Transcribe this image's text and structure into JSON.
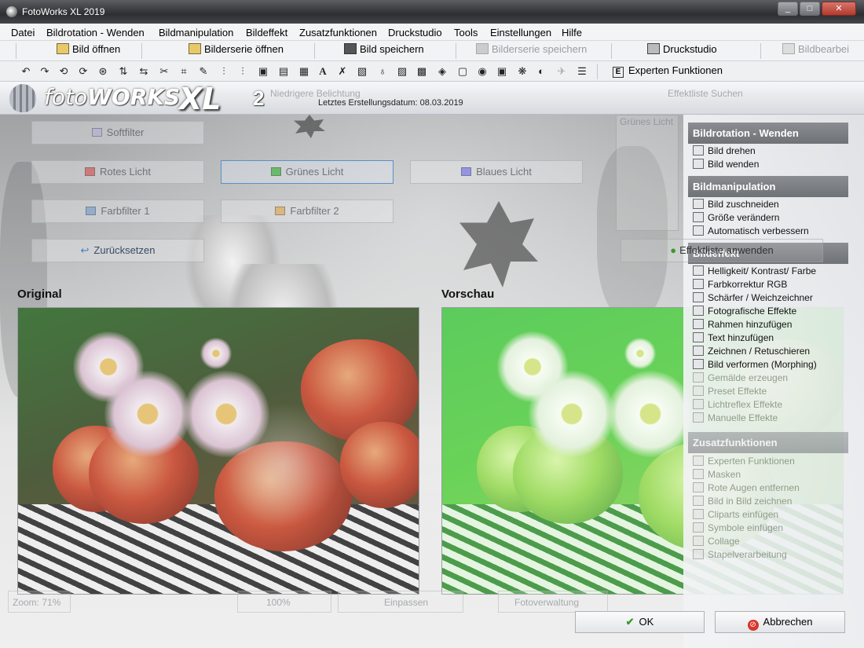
{
  "window": {
    "title": "FotoWorks XL 2019"
  },
  "menu": [
    "Datei",
    "Bildrotation - Wenden",
    "Bildmanipulation",
    "Bildeffekt",
    "Zusatzfunktionen",
    "Druckstudio",
    "Tools",
    "Einstellungen",
    "Hilfe"
  ],
  "toolbar": {
    "open": "Bild öffnen",
    "open_series": "Bilderserie öffnen",
    "save": "Bild speichern",
    "save_series": "Bilderserie speichern",
    "print": "Druckstudio",
    "edit": "Bildbearbei",
    "expert": "Experten Funktionen"
  },
  "banner": {
    "logo_foto": "foto",
    "logo_works": "WORKS",
    "logo_xl": "XL",
    "logo_version": "2",
    "ghost_label": "Niedrigere Belichtung",
    "created": "Letztes Erstellungsdatum: 08.03.2019",
    "ghost_right": "Effektliste Suchen"
  },
  "filters": {
    "soft": "Softfilter",
    "red": "Rotes Licht",
    "green": "Grünes Licht",
    "blue": "Blaues Licht",
    "f1": "Farbfilter 1",
    "f2": "Farbfilter 2",
    "reset": "Zurücksetzen",
    "apply_list": "Effektliste anwenden",
    "preview_hint": "Grünes Licht"
  },
  "panels": {
    "original": "Original",
    "preview": "Vorschau"
  },
  "sidebar": {
    "sections": [
      {
        "title": "Bildrotation - Wenden",
        "items": [
          "Bild drehen",
          "Bild wenden"
        ]
      },
      {
        "title": "Bildmanipulation",
        "items": [
          "Bild zuschneiden",
          "Größe verändern",
          "Automatisch verbessern"
        ]
      },
      {
        "title": "Bildeffekt",
        "items": [
          "Helligkeit/ Kontrast/ Farbe",
          "Farbkorrektur RGB",
          "Schärfer / Weichzeichner",
          "Fotografische Effekte",
          "Rahmen hinzufügen",
          "Text hinzufügen",
          "Zeichnen / Retuschieren",
          "Bild verformen (Morphing)",
          "Gemälde erzeugen",
          "Preset Effekte",
          "Lichtreflex Effekte",
          "Manuelle Effekte"
        ]
      },
      {
        "title": "Zusatzfunktionen",
        "items": [
          "Experten Funktionen",
          "Masken",
          "Rote Augen entfernen",
          "Bild in Bild zeichnen",
          "Cliparts einfügen",
          "Symbole einfügen",
          "Collage",
          "Stapelverarbeitung"
        ]
      }
    ]
  },
  "bottom": {
    "zoom": "Zoom: 71%",
    "zoom100": "100%",
    "fit": "Einpassen",
    "manager": "Fotoverwaltung"
  },
  "dialog": {
    "ok": "OK",
    "cancel": "Abbrechen"
  },
  "colors": {
    "accent": "#5d8fc9",
    "section": "#7d8085",
    "green_preview": "#4fcd3a",
    "cancel_icon": "#d9352a"
  }
}
